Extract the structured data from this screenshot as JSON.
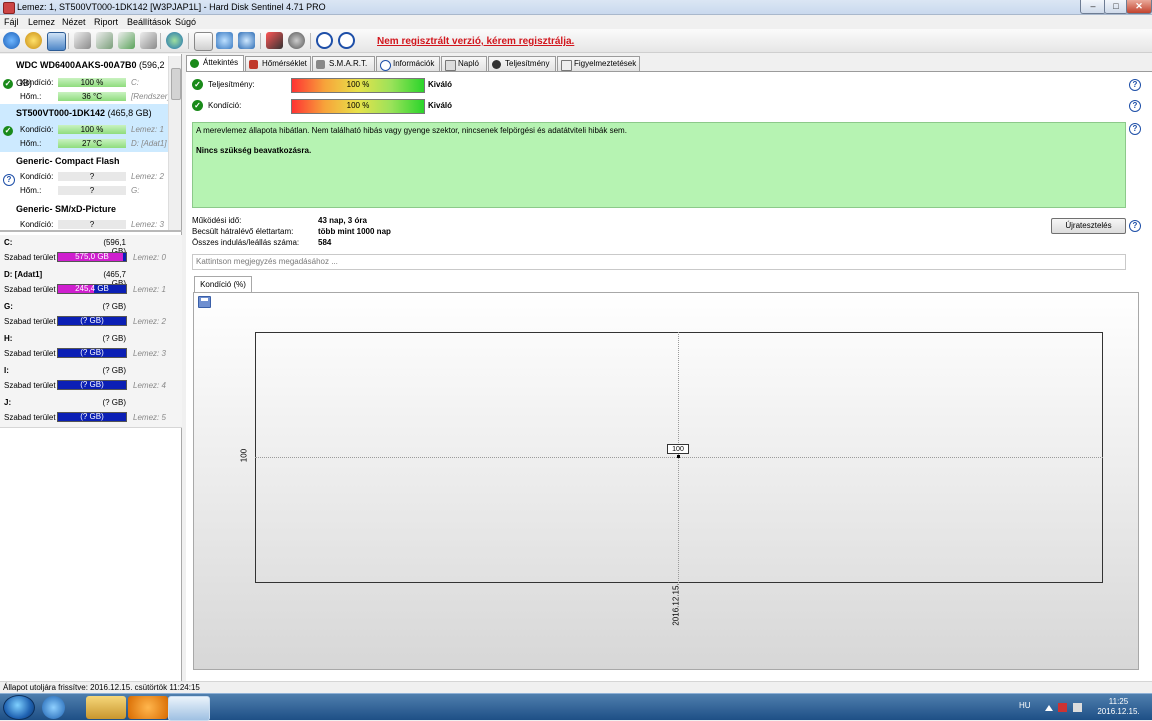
{
  "window": {
    "title": "Lemez: 1, ST500VT000-1DK142 [W3PJAP1L]  -  Hard Disk Sentinel 4.71 PRO",
    "minimize": "–",
    "maximize": "□",
    "close": "✕"
  },
  "menu": [
    "Fájl",
    "Lemez",
    "Nézet",
    "Riport",
    "Beállítások",
    "Súgó"
  ],
  "toolbar": {
    "register_link": "Nem regisztrált verzió, kérem regisztrálja."
  },
  "disks": [
    {
      "name": "WDC WD6400AAKS-00A7B0",
      "size": "(596,2 GB)",
      "status": "ok",
      "condition_label": "Kondíció:",
      "condition": "100 %",
      "temp_label": "Hőm.:",
      "temp": "36 °C",
      "side1": "C:",
      "side2": "[Rendszer]"
    },
    {
      "name": "ST500VT000-1DK142",
      "size": "(465,8 GB)",
      "status": "ok",
      "condition_label": "Kondíció:",
      "condition": "100 %",
      "temp_label": "Hőm.:",
      "temp": "27 °C",
      "side1": "Lemez: 1",
      "side2": "D: [Adat1]"
    },
    {
      "name": "Generic- Compact Flash",
      "size": "",
      "status": "unknown",
      "condition_label": "Kondíció:",
      "condition": "?",
      "temp_label": "Hőm.:",
      "temp": "?",
      "side1": "Lemez: 2",
      "side2": "G:"
    },
    {
      "name": "Generic- SM/xD-Picture",
      "size": "",
      "status": "unknown",
      "condition_label": "Kondíció:",
      "condition": "?",
      "temp_label": "",
      "temp": "",
      "side1": "Lemez: 3",
      "side2": ""
    }
  ],
  "partitions": [
    {
      "letter": "C:",
      "size": "(596,1 GB)",
      "free_label": "Szabad terület",
      "free": "575,0 GB",
      "free_ratio": 0.96,
      "disk": "Lemez: 0"
    },
    {
      "letter": "D: [Adat1]",
      "size": "(465,7 GB)",
      "free_label": "Szabad terület",
      "free": "245,4 GB",
      "free_ratio": 0.53,
      "disk": "Lemez: 1"
    },
    {
      "letter": "G:",
      "size": "(? GB)",
      "free_label": "Szabad terület",
      "free": "(? GB)",
      "free_ratio": 0,
      "disk": "Lemez: 2"
    },
    {
      "letter": "H:",
      "size": "(? GB)",
      "free_label": "Szabad terület",
      "free": "(? GB)",
      "free_ratio": 0,
      "disk": "Lemez: 3"
    },
    {
      "letter": "I:",
      "size": "(? GB)",
      "free_label": "Szabad terület",
      "free": "(? GB)",
      "free_ratio": 0,
      "disk": "Lemez: 4"
    },
    {
      "letter": "J:",
      "size": "(? GB)",
      "free_label": "Szabad terület",
      "free": "(? GB)",
      "free_ratio": 0,
      "disk": "Lemez: 5"
    }
  ],
  "tabs": [
    "Áttekintés",
    "Hőmérséklet",
    "S.M.A.R.T.",
    "Információk",
    "Napló",
    "Teljesítmény",
    "Figyelmeztetések"
  ],
  "overview": {
    "performance_label": "Teljesítmény:",
    "performance": "100 %",
    "performance_rating": "Kiváló",
    "condition_label": "Kondíció:",
    "condition": "100 %",
    "condition_rating": "Kiváló",
    "status_text": "A merevlemez állapota hibátlan. Nem található hibás vagy gyenge szektor, nincsenek felpörgési és adatátviteli hibák sem.",
    "status_action": "Nincs szükség beavatkozásra.",
    "uptime_label": "Működési idő:",
    "uptime": "43 nap, 3 óra",
    "remaining_label": "Becsült hátralévő élettartam:",
    "remaining": "több mint 1000 nap",
    "starts_label": "Összes indulás/leállás száma:",
    "starts": "584",
    "reset_button": "Újratesztelés",
    "note_placeholder": "Kattintson megjegyzés megadásához ..."
  },
  "chart_tab": "Kondíció  (%)",
  "chart_data": {
    "type": "line",
    "series": [
      {
        "x": [
          "2016.12.15."
        ],
        "values": [
          100
        ]
      }
    ],
    "ytick": "100",
    "xtick": "2016.12.15.",
    "point_label": "100"
  },
  "statusbar": "Állapot utoljára frissítve: 2016.12.15. csütörtök 11:24:15",
  "taskbar": {
    "lang": "HU",
    "time": "11:25",
    "date": "2016.12.15."
  }
}
